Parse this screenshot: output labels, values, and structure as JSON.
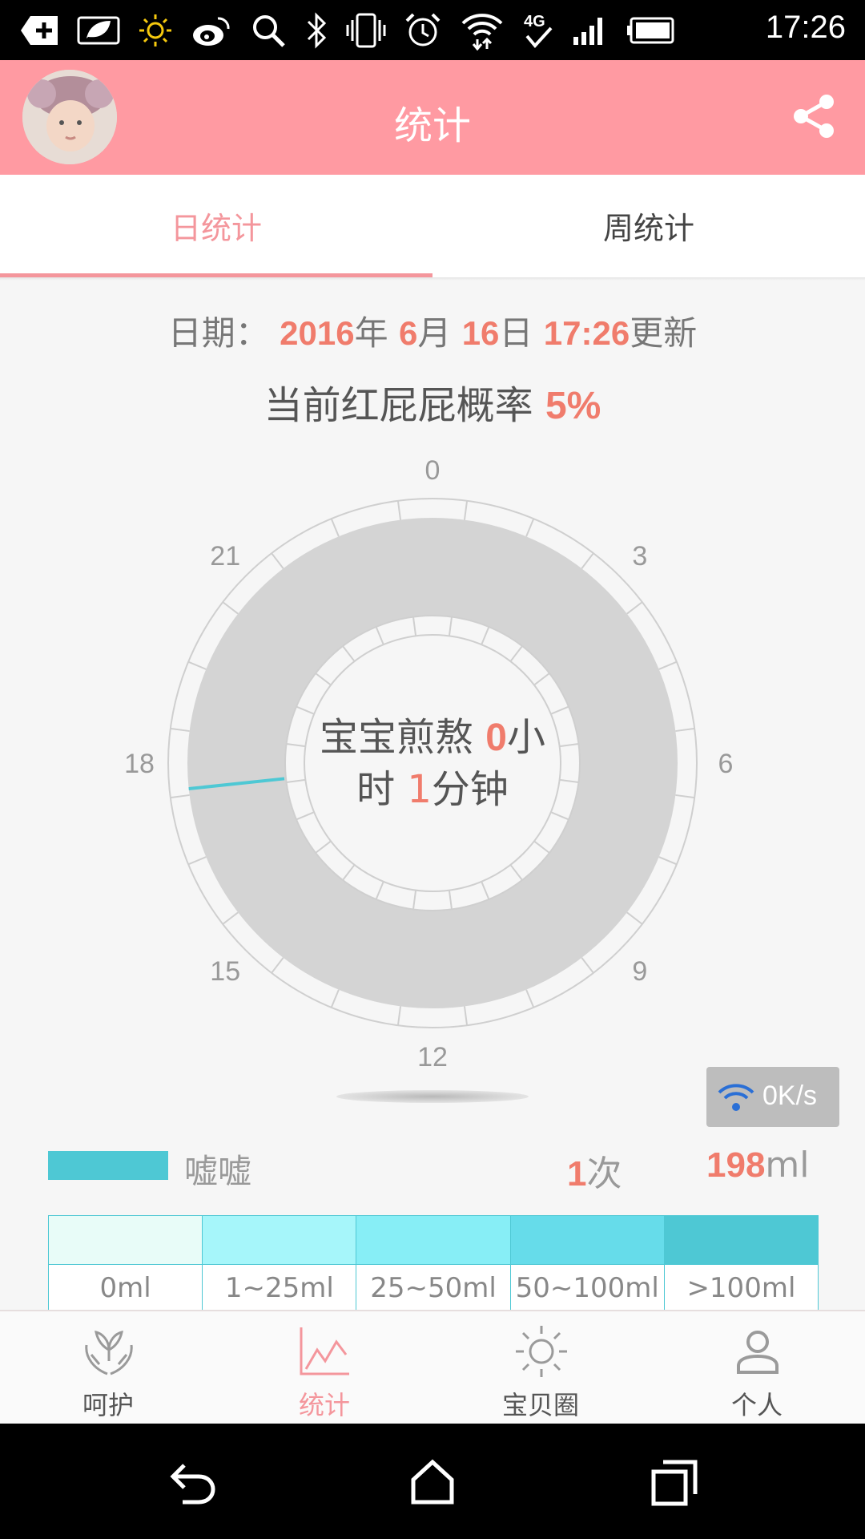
{
  "status_bar": {
    "time": "17:26",
    "icons": [
      "add-icon",
      "leaf-icon",
      "sun-icon",
      "weibo-icon",
      "search-icon",
      "bluetooth-icon",
      "vibrate-icon",
      "alarm-icon",
      "wifi-icon",
      "4g-icon",
      "signal-icon",
      "battery-icon"
    ]
  },
  "header": {
    "title": "统计",
    "avatar": "baby-avatar",
    "share_icon": "share-icon"
  },
  "tabs": [
    {
      "label": "日统计",
      "active": true
    },
    {
      "label": "周统计",
      "active": false
    }
  ],
  "date_line": {
    "prefix": "日期：",
    "year": "2016",
    "year_unit": "年",
    "month": "6",
    "month_unit": "月",
    "day": "16",
    "day_unit": "日",
    "time": "17:26",
    "suffix": "更新"
  },
  "probability": {
    "label": "当前红屁屁概率",
    "value": "5%"
  },
  "dial": {
    "hour_labels": [
      "0",
      "3",
      "6",
      "9",
      "12",
      "15",
      "18",
      "21"
    ],
    "event_hour": 17.6,
    "event_color": "#4ec8d4",
    "center_prefix": "宝宝煎熬",
    "hours": "0",
    "hours_unit": "小",
    "center_line2_prefix": "时",
    "minutes": "1",
    "minutes_unit": "分钟"
  },
  "speed_badge": {
    "icon": "wifi-icon",
    "value": "0K/s"
  },
  "legend": {
    "label": "嘘嘘",
    "count": "1",
    "count_unit": "次",
    "volume": "198",
    "volume_unit": "ml",
    "color": "#4ec8d4"
  },
  "scale": [
    {
      "label": "0ml",
      "color": "#e8fcf8"
    },
    {
      "label": "1~25ml",
      "color": "#a6f6fa"
    },
    {
      "label": "25~50ml",
      "color": "#87eef6"
    },
    {
      "label": "50~100ml",
      "color": "#66dcea"
    },
    {
      "label": ">100ml",
      "color": "#4ec8d4"
    }
  ],
  "bottom_nav": [
    {
      "label": "呵护",
      "icon": "care-hands-icon",
      "active": false
    },
    {
      "label": "统计",
      "icon": "chart-icon",
      "active": true
    },
    {
      "label": "宝贝圈",
      "icon": "sun-icon",
      "active": false
    },
    {
      "label": "个人",
      "icon": "person-icon",
      "active": false
    }
  ],
  "colors": {
    "primary": "#ff9aa2",
    "accent_text": "#f07c6c",
    "tab_active": "#f4969c",
    "pee": "#4ec8d4"
  }
}
